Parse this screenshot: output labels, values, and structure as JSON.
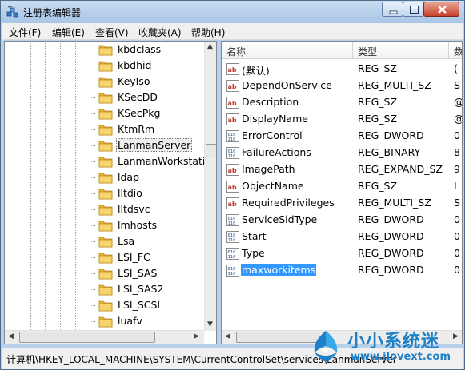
{
  "window": {
    "title": "注册表编辑器"
  },
  "menu": [
    {
      "label": "文件(F)"
    },
    {
      "label": "编辑(E)"
    },
    {
      "label": "查看(V)"
    },
    {
      "label": "收藏夹(A)"
    },
    {
      "label": "帮助(H)"
    }
  ],
  "tree": {
    "selected": "LanmanServer",
    "items": [
      {
        "label": "kbdclass"
      },
      {
        "label": "kbdhid"
      },
      {
        "label": "KeyIso"
      },
      {
        "label": "KSecDD"
      },
      {
        "label": "KSecPkg"
      },
      {
        "label": "KtmRm"
      },
      {
        "label": "LanmanServer"
      },
      {
        "label": "LanmanWorkstatio"
      },
      {
        "label": "ldap"
      },
      {
        "label": "lltdio"
      },
      {
        "label": "lltdsvc"
      },
      {
        "label": "lmhosts"
      },
      {
        "label": "Lsa"
      },
      {
        "label": "LSI_FC"
      },
      {
        "label": "LSI_SAS"
      },
      {
        "label": "LSI_SAS2"
      },
      {
        "label": "LSI_SCSI"
      },
      {
        "label": "luafv"
      }
    ]
  },
  "list": {
    "columns": [
      {
        "label": "名称"
      },
      {
        "label": "类型"
      },
      {
        "label": "数"
      }
    ],
    "selected": "maxworkitems",
    "rows": [
      {
        "name": "(默认)",
        "type": "REG_SZ",
        "data": "(",
        "icon": "string-value-icon"
      },
      {
        "name": "DependOnService",
        "type": "REG_MULTI_SZ",
        "data": "S",
        "icon": "string-value-icon"
      },
      {
        "name": "Description",
        "type": "REG_SZ",
        "data": "@",
        "icon": "string-value-icon"
      },
      {
        "name": "DisplayName",
        "type": "REG_SZ",
        "data": "@",
        "icon": "string-value-icon"
      },
      {
        "name": "ErrorControl",
        "type": "REG_DWORD",
        "data": "0",
        "icon": "binary-value-icon"
      },
      {
        "name": "FailureActions",
        "type": "REG_BINARY",
        "data": "8",
        "icon": "binary-value-icon"
      },
      {
        "name": "ImagePath",
        "type": "REG_EXPAND_SZ",
        "data": "9",
        "icon": "string-value-icon"
      },
      {
        "name": "ObjectName",
        "type": "REG_SZ",
        "data": "L",
        "icon": "string-value-icon"
      },
      {
        "name": "RequiredPrivileges",
        "type": "REG_MULTI_SZ",
        "data": "S",
        "icon": "string-value-icon"
      },
      {
        "name": "ServiceSidType",
        "type": "REG_DWORD",
        "data": "0",
        "icon": "binary-value-icon"
      },
      {
        "name": "Start",
        "type": "REG_DWORD",
        "data": "0",
        "icon": "binary-value-icon"
      },
      {
        "name": "Type",
        "type": "REG_DWORD",
        "data": "0",
        "icon": "binary-value-icon"
      },
      {
        "name": "maxworkitems",
        "type": "REG_DWORD",
        "data": "0",
        "icon": "binary-value-icon"
      }
    ]
  },
  "statusbar": {
    "path": "计算机\\HKEY_LOCAL_MACHINE\\SYSTEM\\CurrentControlSet\\services\\LanmanServer"
  },
  "watermark": {
    "text": "小小系统迷",
    "url": "www.ilovext.com"
  },
  "colors": {
    "selection": "#3399ff",
    "titlebar": "#b9d1ea",
    "watermark": "#1f80c8",
    "folder": "#f2c94c"
  }
}
